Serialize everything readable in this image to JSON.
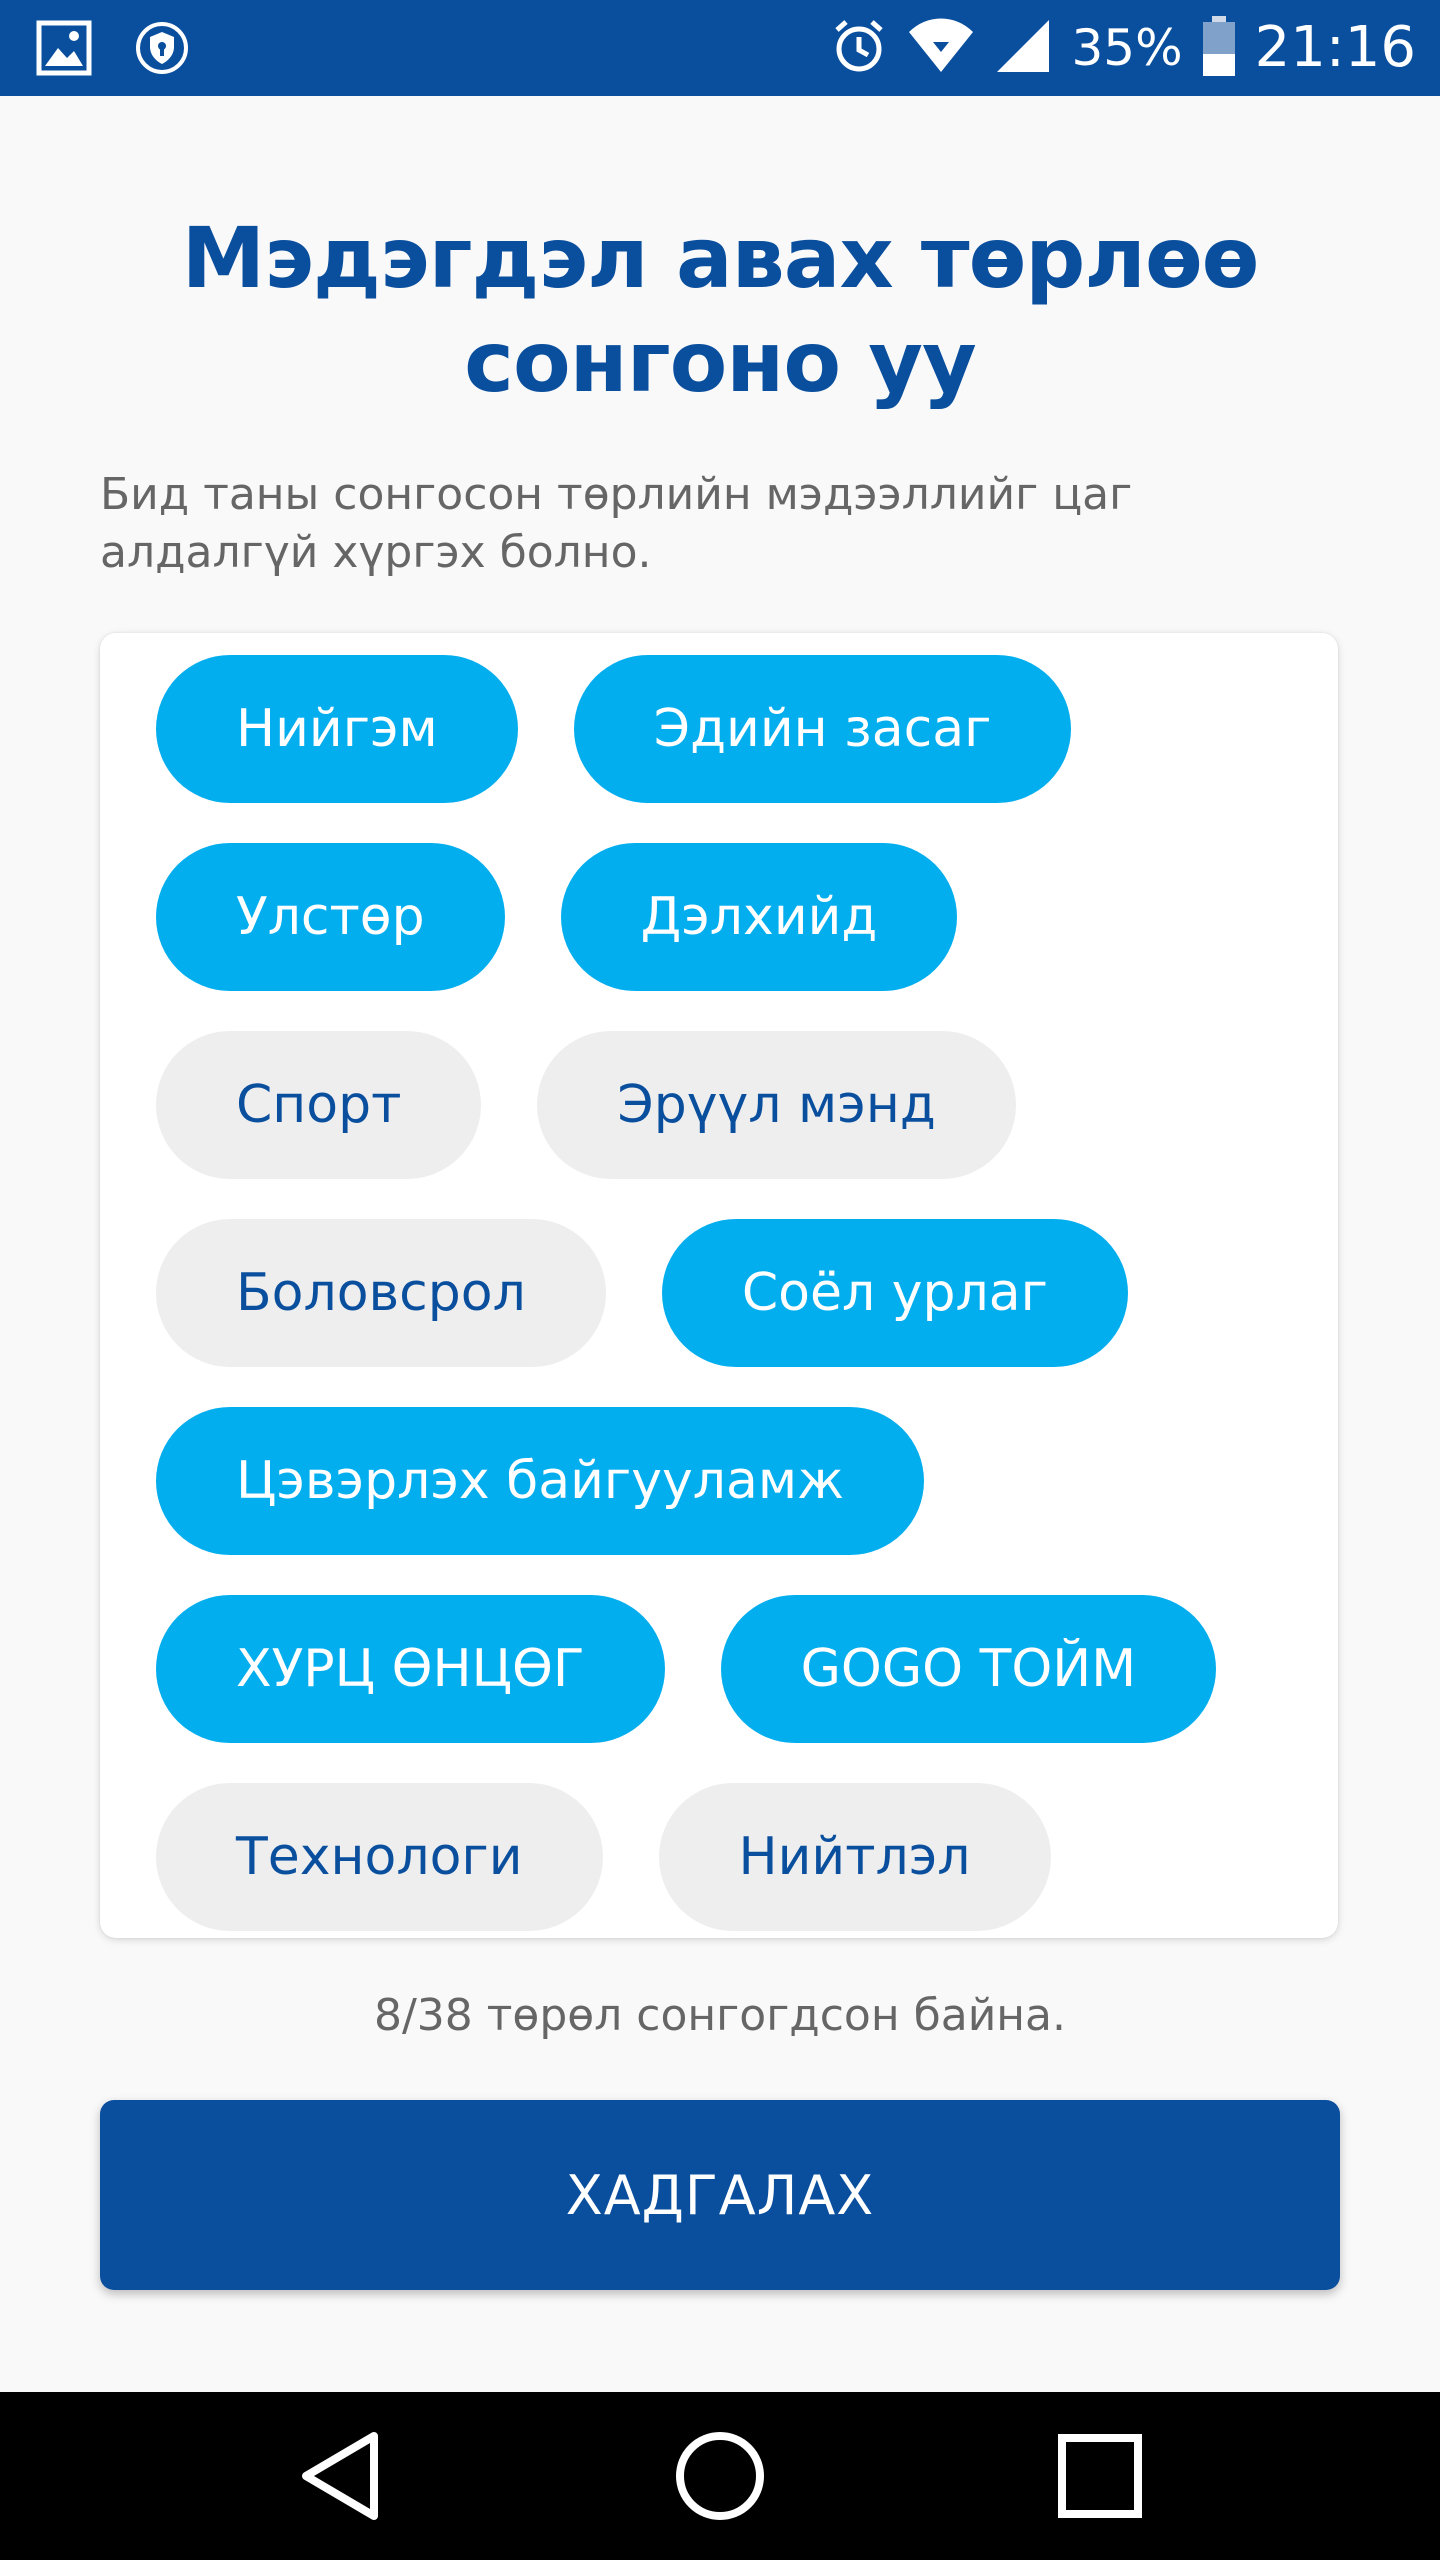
{
  "status_bar": {
    "battery_percent": "35%",
    "time": "21:16",
    "icons": [
      "gallery-icon",
      "vpn-shield-icon",
      "alarm-icon",
      "wifi-icon",
      "signal-icon",
      "battery-icon"
    ]
  },
  "header": {
    "title_line1": "Мэдэгдэл авах төрлөө",
    "title_line2": "сонгоно уу",
    "subtitle": "Бид таны сонгосон төрлийн мэдээллийг цаг алдалгүй хүргэх болно."
  },
  "categories": [
    {
      "label": "Нийгэм",
      "selected": true
    },
    {
      "label": "Эдийн засаг",
      "selected": true
    },
    {
      "label": "Улстөр",
      "selected": true
    },
    {
      "label": "Дэлхийд",
      "selected": true
    },
    {
      "label": "Спорт",
      "selected": false
    },
    {
      "label": "Эрүүл мэнд",
      "selected": false
    },
    {
      "label": "Боловсрол",
      "selected": false
    },
    {
      "label": "Соёл урлаг",
      "selected": true
    },
    {
      "label": "Цэвэрлэх байгууламж",
      "selected": true
    },
    {
      "label": "ХУРЦ ӨНЦӨГ",
      "selected": true
    },
    {
      "label": "GOGO ТОЙМ",
      "selected": true
    },
    {
      "label": "Технологи",
      "selected": false
    },
    {
      "label": "Нийтлэл",
      "selected": false
    }
  ],
  "footer": {
    "count_text": "8/38 төрөл сонгогдсон байна.",
    "save_label": "ХАДГАЛАХ"
  },
  "colors": {
    "primary": "#0a4f9e",
    "chip_selected": "#03aeef",
    "chip_unselected": "#eeeeee",
    "background": "#f9f9f9"
  },
  "nav": {
    "icons": [
      "back-icon",
      "home-icon",
      "recents-icon"
    ]
  }
}
